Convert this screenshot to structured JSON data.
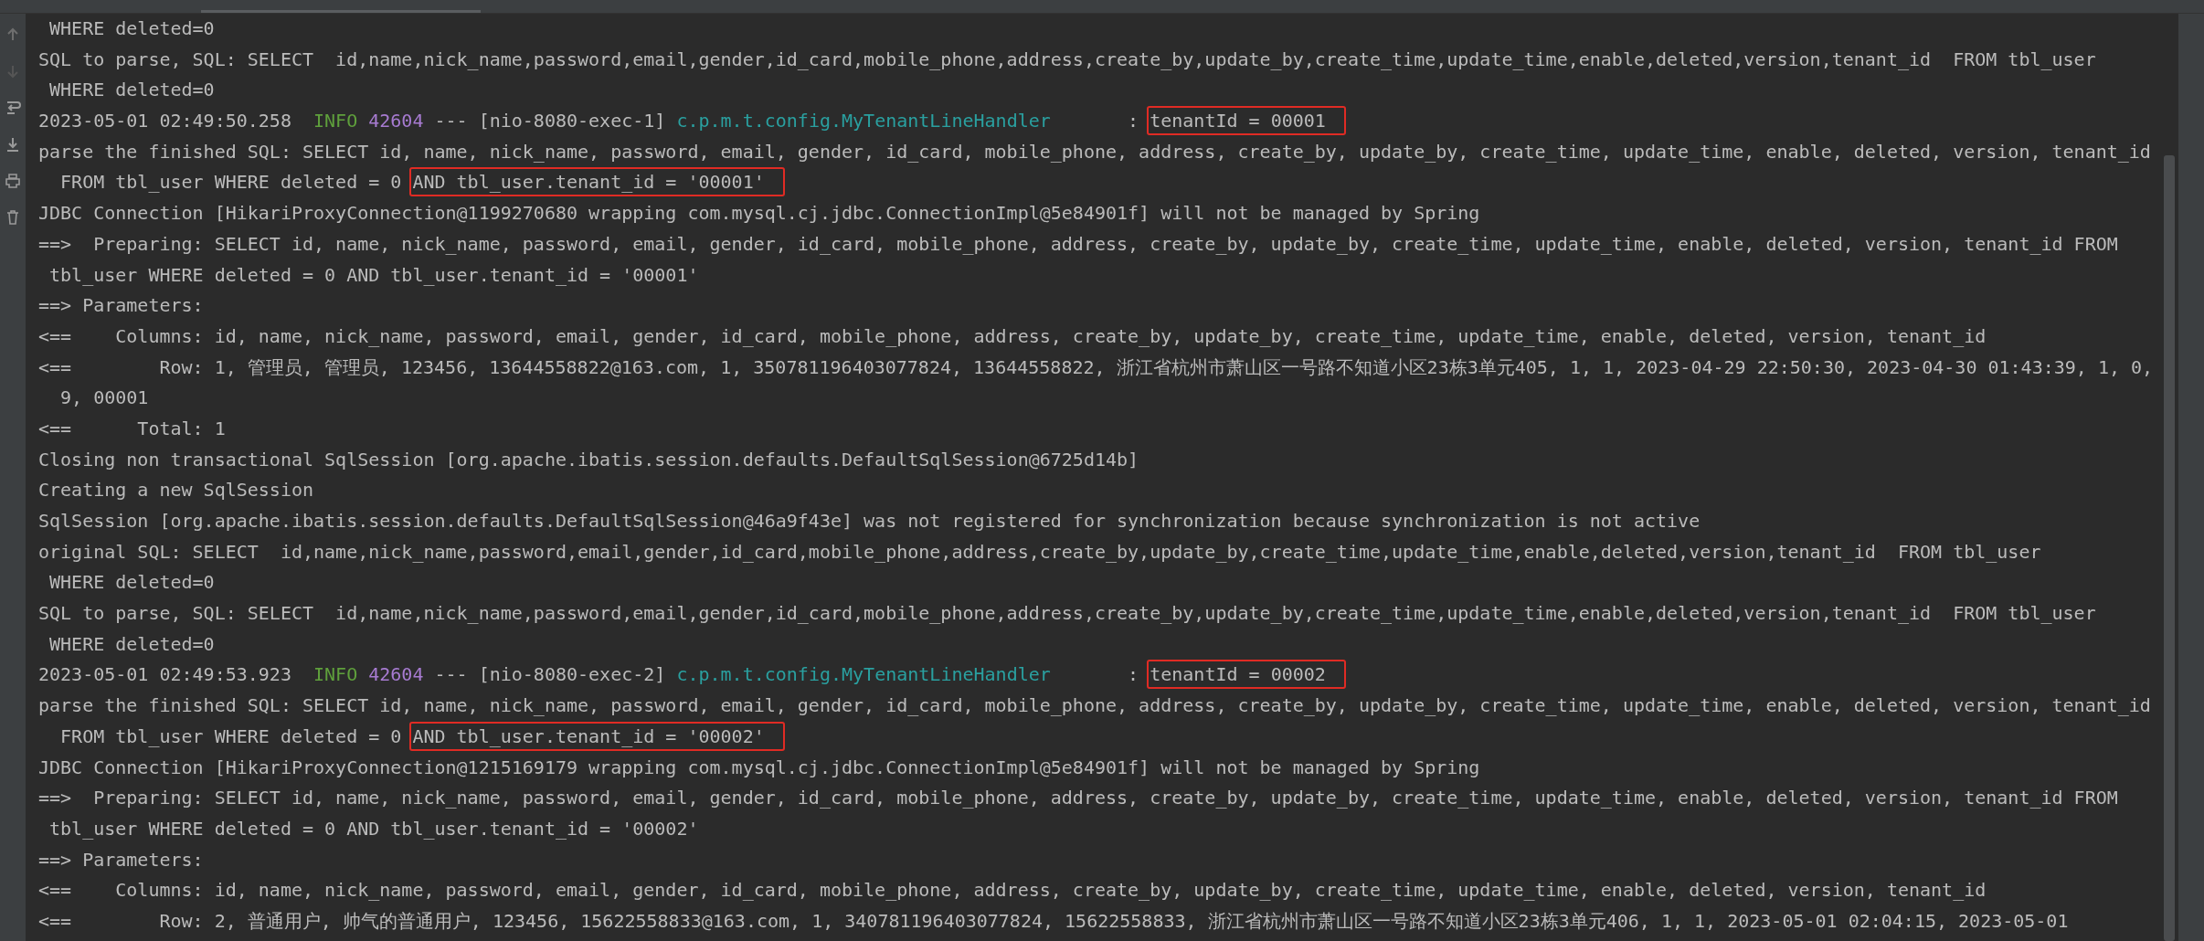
{
  "console": {
    "lines": [
      {
        "segments": [
          {
            "kind": "text",
            "text": " WHERE deleted=0"
          }
        ]
      },
      {
        "segments": [
          {
            "kind": "text",
            "text": "SQL to parse, SQL: SELECT  id,name,nick_name,password,email,gender,id_card,mobile_phone,address,create_by,update_by,create_time,update_time,enable,deleted,version,tenant_id  FROM tbl_user"
          }
        ]
      },
      {
        "segments": [
          {
            "kind": "text",
            "text": " WHERE deleted=0"
          }
        ]
      },
      {
        "segments": [
          {
            "kind": "text",
            "text": "2023-05-01 02:49:50.258  "
          },
          {
            "kind": "level",
            "text": "INFO"
          },
          {
            "kind": "pid",
            "text": "42604"
          },
          {
            "kind": "text",
            "text": " --- [nio-8080-exec-1] "
          },
          {
            "kind": "logger",
            "text": "c.p.m.t.config.MyTenantLineHandler"
          },
          {
            "kind": "text",
            "text": "       : "
          },
          {
            "kind": "boxed",
            "text": "tenantId = 00001"
          }
        ]
      },
      {
        "segments": [
          {
            "kind": "text",
            "text": "parse the finished SQL: SELECT id, name, nick_name, password, email, gender, id_card, mobile_phone, address, create_by, update_by, create_time, update_time, enable, deleted, version, tenant_id"
          }
        ]
      },
      {
        "segments": [
          {
            "kind": "text",
            "text": "  FROM tbl_user WHERE deleted = 0 "
          },
          {
            "kind": "boxed",
            "text": "AND tbl_user.tenant_id = '00001'"
          }
        ]
      },
      {
        "segments": [
          {
            "kind": "text",
            "text": "JDBC Connection [HikariProxyConnection@1199270680 wrapping com.mysql.cj.jdbc.ConnectionImpl@5e84901f] will not be managed by Spring"
          }
        ]
      },
      {
        "segments": [
          {
            "kind": "text",
            "text": "==>  Preparing: SELECT id, name, nick_name, password, email, gender, id_card, mobile_phone, address, create_by, update_by, create_time, update_time, enable, deleted, version, tenant_id FROM"
          }
        ]
      },
      {
        "segments": [
          {
            "kind": "text",
            "text": " tbl_user WHERE deleted = 0 AND tbl_user.tenant_id = '00001'"
          }
        ]
      },
      {
        "segments": [
          {
            "kind": "text",
            "text": "==> Parameters: "
          }
        ]
      },
      {
        "segments": [
          {
            "kind": "text",
            "text": "<==    Columns: id, name, nick_name, password, email, gender, id_card, mobile_phone, address, create_by, update_by, create_time, update_time, enable, deleted, version, tenant_id"
          }
        ]
      },
      {
        "segments": [
          {
            "kind": "text",
            "text": "<==        Row: 1, 管理员, 管理员, 123456, 13644558822@163.com, 1, 350781196403077824, 13644558822, 浙江省杭州市萧山区一号路不知道小区23栋3单元405, 1, 1, 2023-04-29 22:50:30, 2023-04-30 01:43:39, 1, 0,"
          }
        ]
      },
      {
        "segments": [
          {
            "kind": "text",
            "text": "  9, 00001"
          }
        ]
      },
      {
        "segments": [
          {
            "kind": "text",
            "text": "<==      Total: 1"
          }
        ]
      },
      {
        "segments": [
          {
            "kind": "text",
            "text": "Closing non transactional SqlSession [org.apache.ibatis.session.defaults.DefaultSqlSession@6725d14b]"
          }
        ]
      },
      {
        "segments": [
          {
            "kind": "text",
            "text": "Creating a new SqlSession"
          }
        ]
      },
      {
        "segments": [
          {
            "kind": "text",
            "text": "SqlSession [org.apache.ibatis.session.defaults.DefaultSqlSession@46a9f43e] was not registered for synchronization because synchronization is not active"
          }
        ]
      },
      {
        "segments": [
          {
            "kind": "text",
            "text": "original SQL: SELECT  id,name,nick_name,password,email,gender,id_card,mobile_phone,address,create_by,update_by,create_time,update_time,enable,deleted,version,tenant_id  FROM tbl_user"
          }
        ]
      },
      {
        "segments": [
          {
            "kind": "text",
            "text": " WHERE deleted=0"
          }
        ]
      },
      {
        "segments": [
          {
            "kind": "text",
            "text": "SQL to parse, SQL: SELECT  id,name,nick_name,password,email,gender,id_card,mobile_phone,address,create_by,update_by,create_time,update_time,enable,deleted,version,tenant_id  FROM tbl_user"
          }
        ]
      },
      {
        "segments": [
          {
            "kind": "text",
            "text": " WHERE deleted=0"
          }
        ]
      },
      {
        "segments": [
          {
            "kind": "text",
            "text": "2023-05-01 02:49:53.923  "
          },
          {
            "kind": "level",
            "text": "INFO"
          },
          {
            "kind": "pid",
            "text": "42604"
          },
          {
            "kind": "text",
            "text": " --- [nio-8080-exec-2] "
          },
          {
            "kind": "logger",
            "text": "c.p.m.t.config.MyTenantLineHandler"
          },
          {
            "kind": "text",
            "text": "       : "
          },
          {
            "kind": "boxed",
            "text": "tenantId = 00002"
          }
        ]
      },
      {
        "segments": [
          {
            "kind": "text",
            "text": "parse the finished SQL: SELECT id, name, nick_name, password, email, gender, id_card, mobile_phone, address, create_by, update_by, create_time, update_time, enable, deleted, version, tenant_id"
          }
        ]
      },
      {
        "segments": [
          {
            "kind": "text",
            "text": "  FROM tbl_user WHERE deleted = 0 "
          },
          {
            "kind": "boxed",
            "text": "AND tbl_user.tenant_id = '00002'"
          }
        ]
      },
      {
        "segments": [
          {
            "kind": "text",
            "text": "JDBC Connection [HikariProxyConnection@1215169179 wrapping com.mysql.cj.jdbc.ConnectionImpl@5e84901f] will not be managed by Spring"
          }
        ]
      },
      {
        "segments": [
          {
            "kind": "text",
            "text": "==>  Preparing: SELECT id, name, nick_name, password, email, gender, id_card, mobile_phone, address, create_by, update_by, create_time, update_time, enable, deleted, version, tenant_id FROM"
          }
        ]
      },
      {
        "segments": [
          {
            "kind": "text",
            "text": " tbl_user WHERE deleted = 0 AND tbl_user.tenant_id = '00002'"
          }
        ]
      },
      {
        "segments": [
          {
            "kind": "text",
            "text": "==> Parameters: "
          }
        ]
      },
      {
        "segments": [
          {
            "kind": "text",
            "text": "<==    Columns: id, name, nick_name, password, email, gender, id_card, mobile_phone, address, create_by, update_by, create_time, update_time, enable, deleted, version, tenant_id"
          }
        ]
      },
      {
        "segments": [
          {
            "kind": "text",
            "text": "<==        Row: 2, 普通用户, 帅气的普通用户, 123456, 15622558833@163.com, 1, 340781196403077824, 15622558833, 浙江省杭州市萧山区一号路不知道小区23栋3单元406, 1, 1, 2023-05-01 02:04:15, 2023-05-01"
          }
        ]
      }
    ]
  }
}
